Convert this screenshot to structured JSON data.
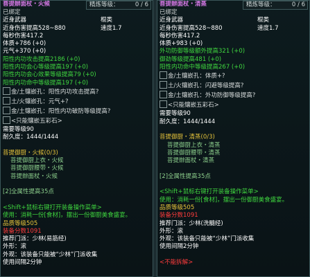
{
  "left": {
    "title": "菩提辦面杖・火候",
    "refine_label": "精炼等级：",
    "refine_value": "0 / 6",
    "lines": [
      {
        "t": "已绑定",
        "c": "gry"
      },
      {
        "t": "近身武器",
        "r": "棍类",
        "c": "wh"
      },
      {
        "t": "近身伤害提高528~880",
        "r": "速度1.7",
        "c": "wh"
      },
      {
        "t": "每秒伤害417.2",
        "c": "wh"
      },
      {
        "t": "体质+786 (+0)",
        "c": "wh"
      },
      {
        "t": "元气+370 (+0)",
        "c": "wh"
      },
      {
        "t": "阳性内功攻击提高2186 (+0)",
        "c": "g"
      },
      {
        "t": "阳性内功会心等级提高197 (+0)",
        "c": "g"
      },
      {
        "t": "阳性内功会心效果等级提高79 (+0)",
        "c": "g"
      },
      {
        "t": "阳性内功命中等级提高197 (+0)",
        "c": "g"
      }
    ],
    "slots": [
      "金/土镶嵌孔：阳性内功攻击提高?",
      "土/火镶嵌孔：元气+?",
      "金/土镶嵌孔：阳性内功破防等级提高?",
      "<只能镶嵌五彩石>"
    ],
    "after": [
      {
        "t": "需要等级90",
        "c": "wh"
      },
      {
        "t": "耐久度：1444/1444",
        "c": "wh"
      },
      {
        "t": "",
        "c": "sp"
      },
      {
        "t": "菩提御厨・火候(0/3)",
        "c": "yel"
      },
      {
        "t": "菩提御厨上衣・火候",
        "c": "dg",
        "i": 1
      },
      {
        "t": "菩提御厨腰带・火候",
        "c": "dg",
        "i": 1
      },
      {
        "t": "菩提辦面杖・火候",
        "c": "dg",
        "i": 1
      },
      {
        "t": "",
        "c": "sp"
      },
      {
        "t": "[2]全属性提高35点",
        "c": "dg"
      },
      {
        "t": "",
        "c": "sp"
      },
      {
        "t": "<Shift+鼠标右键打开装备操作菜单>",
        "c": "g"
      },
      {
        "t": "使用：消耗一份[食材]，摆出一份御厨美食盛宴。",
        "c": "g"
      },
      {
        "t": "品质等级505",
        "c": "yel"
      },
      {
        "t": "装备分数1091",
        "c": "red"
      },
      {
        "t": "推荐门派：少林(易筋经)",
        "c": "wh"
      },
      {
        "t": "外形：滚",
        "c": "wh"
      },
      {
        "t": "外观：该装备只能被“少林”门派收集",
        "c": "wh"
      },
      {
        "t": "使用间隔2分钟",
        "c": "wh"
      }
    ]
  },
  "right": {
    "title": "菩提辦面杖・清蒸",
    "refine_label": "精炼等级：",
    "refine_value": "0 / 6",
    "lines": [
      {
        "t": "已绑定",
        "c": "gry"
      },
      {
        "t": "近身武器",
        "r": "棍类",
        "c": "wh"
      },
      {
        "t": "近身伤害提高528~880",
        "r": "速度1.7",
        "c": "wh"
      },
      {
        "t": "每秒伤害417.2",
        "c": "wh"
      },
      {
        "t": "体质+983 (+0)",
        "c": "wh"
      },
      {
        "t": "外功防御等级额外提高321 (+0)",
        "c": "g"
      },
      {
        "t": "御劲等级提高481 (+0)",
        "c": "g"
      },
      {
        "t": "阳性内功命中等级提高267 (+0)",
        "c": "g"
      }
    ],
    "slots": [
      "金/土镶嵌孔：体质+?",
      "土/火镶嵌孔：闪避等级提高?",
      "金/土镶嵌孔：外功防御等级提高?",
      "<只能镶嵌五彩石>"
    ],
    "after": [
      {
        "t": "需要等级90",
        "c": "wh"
      },
      {
        "t": "耐久度：1444/1444",
        "c": "wh"
      },
      {
        "t": "",
        "c": "sp"
      },
      {
        "t": "菩提御厨・清蒸(0/3)",
        "c": "yel"
      },
      {
        "t": "菩提御厨上衣・清蒸",
        "c": "dg",
        "i": 1
      },
      {
        "t": "菩提御厨腰带・清蒸",
        "c": "dg",
        "i": 1
      },
      {
        "t": "菩提辦面杖・清蒸",
        "c": "dg",
        "i": 1
      },
      {
        "t": "",
        "c": "sp"
      },
      {
        "t": "[2]全属性提高35点",
        "c": "dg"
      },
      {
        "t": "",
        "c": "sp"
      },
      {
        "t": "<Shift+鼠标右键打开装备操作菜单>",
        "c": "g"
      },
      {
        "t": "使用：消耗一份[食材]，摆出一份御厨美食盛宴。",
        "c": "g"
      },
      {
        "t": "品质等级505",
        "c": "yel"
      },
      {
        "t": "装备分数1091",
        "c": "red"
      },
      {
        "t": "推荐门派：少林(洗髓经)",
        "c": "wh"
      },
      {
        "t": "外形：滚",
        "c": "wh"
      },
      {
        "t": "外观：该装备只能被“少林”门派收集",
        "c": "wh"
      },
      {
        "t": "使用间隔2分钟",
        "c": "wh"
      },
      {
        "t": "",
        "c": "sp"
      },
      {
        "t": "<不能拆解>",
        "c": "red"
      }
    ]
  }
}
